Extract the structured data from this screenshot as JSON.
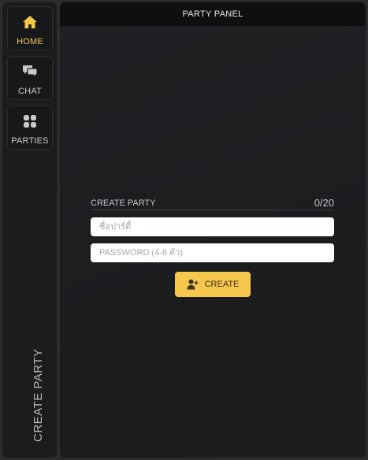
{
  "sidebar": {
    "items": [
      {
        "label": "HOME",
        "icon": "home-icon",
        "active": true
      },
      {
        "label": "CHAT",
        "icon": "chat-icon",
        "active": false
      },
      {
        "label": "PARTIES",
        "icon": "grid-icon",
        "active": false
      }
    ],
    "vertical_title": "CREATE PARTY"
  },
  "panel": {
    "title": "PARTY PANEL",
    "form": {
      "title": "CREATE PARTY",
      "counter": "0/20",
      "name_placeholder": "ชื่อปาร์ตี้",
      "password_placeholder": "PASSWORD (4-8 ตัว)",
      "create_label": "CREATE",
      "create_icon": "add-user-icon"
    }
  },
  "colors": {
    "accent": "#f6c94e",
    "background": "#2b2c2e",
    "panel": "#1c1d1f",
    "header": "#0e0f10"
  }
}
